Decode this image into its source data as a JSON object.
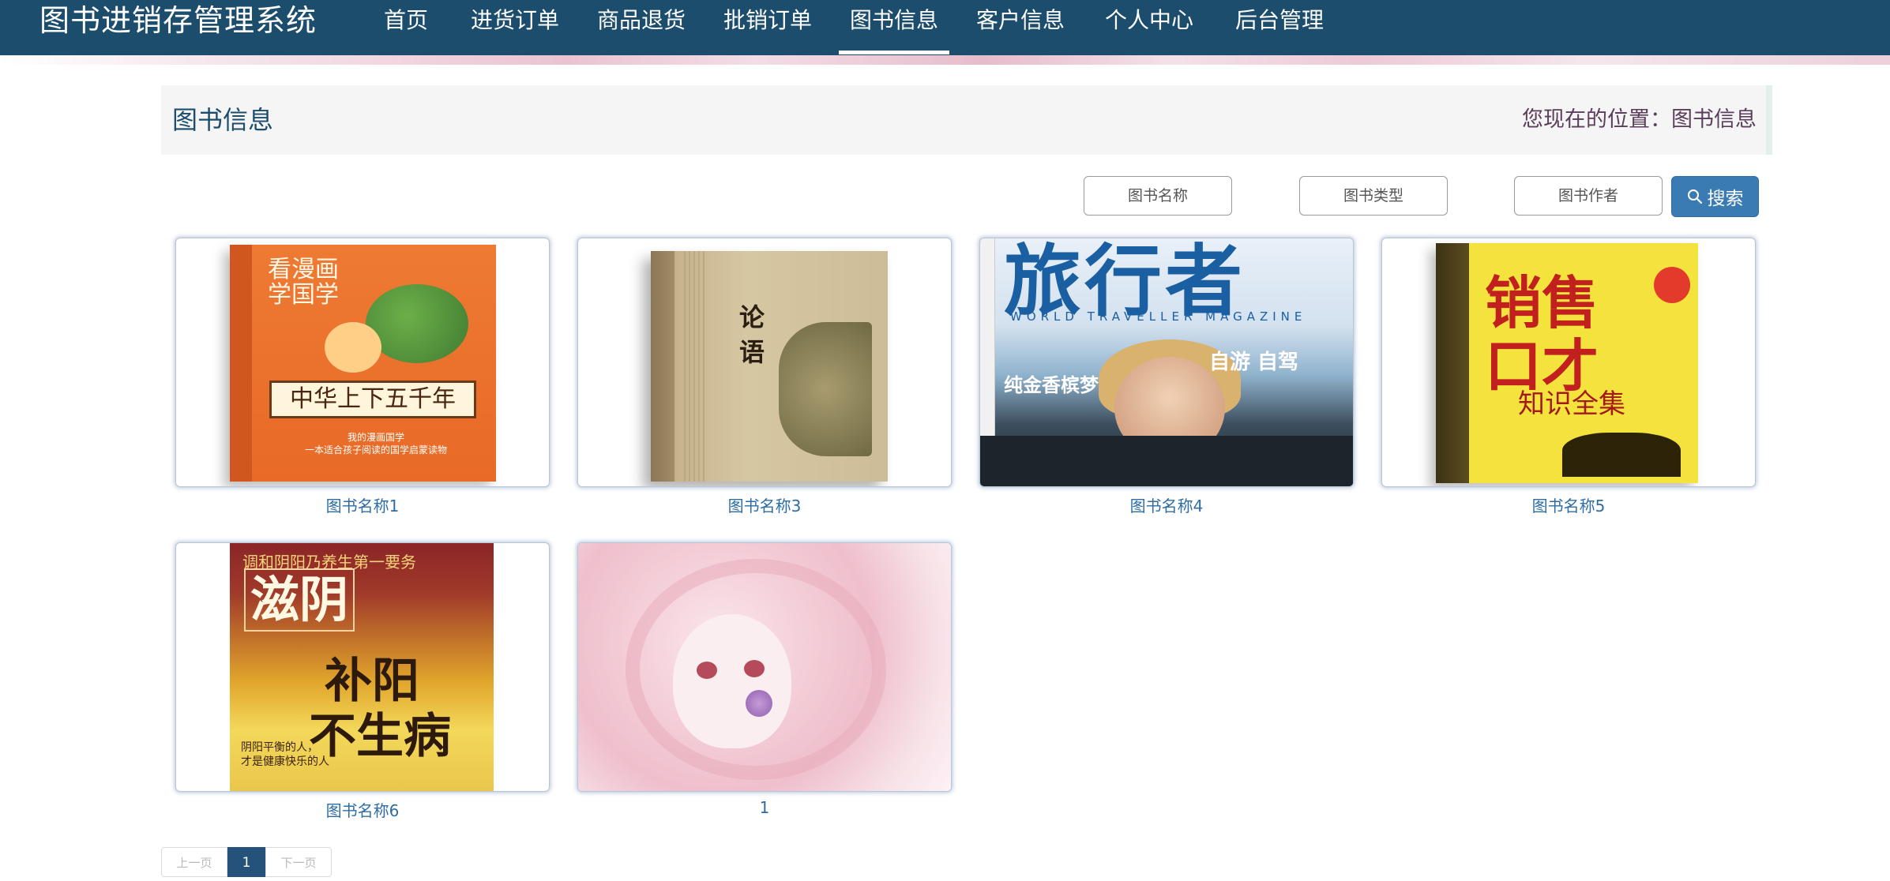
{
  "app": {
    "title": "图书进销存管理系统"
  },
  "nav": {
    "items": [
      {
        "label": "首页"
      },
      {
        "label": "进货订单"
      },
      {
        "label": "商品退货"
      },
      {
        "label": "批销订单"
      },
      {
        "label": "图书信息",
        "active": true
      },
      {
        "label": "客户信息"
      },
      {
        "label": "个人中心"
      },
      {
        "label": "后台管理"
      }
    ]
  },
  "header": {
    "page_title": "图书信息",
    "breadcrumb": "您现在的位置：图书信息"
  },
  "search": {
    "name_placeholder": "图书名称",
    "type_placeholder": "图书类型",
    "author_placeholder": "图书作者",
    "button_label": "搜索",
    "button_icon": "search-icon"
  },
  "books": [
    {
      "name": "图书名称1",
      "cover": "cover-image"
    },
    {
      "name": "图书名称3",
      "cover": "cover-image"
    },
    {
      "name": "图书名称4",
      "cover": "cover-image"
    },
    {
      "name": "图书名称5",
      "cover": "cover-image"
    },
    {
      "name": "图书名称6",
      "cover": "cover-image"
    },
    {
      "name": "1",
      "cover": "cover-image"
    }
  ],
  "covers": {
    "c1": {
      "title_top": "看漫画\n学国学",
      "band": "中华上下五千年",
      "sub": "我的漫画国学\n一本适合孩子阅读的国学启蒙读物"
    },
    "c2": {
      "title": "论\n语"
    },
    "c3": {
      "masthead": "旅行者",
      "strap": "WORLD TRAVELLER MAGAZINE",
      "line1": "纯金香槟梦",
      "line2": "自游 自驾"
    },
    "c4": {
      "big": "销售\n口才",
      "mid": "知识全集"
    },
    "c5": {
      "top": "调和阴阳乃养生第一要务",
      "t1": "滋阴",
      "t2": "补阳",
      "t3": "不生病",
      "sub": "阴阳平衡的人，\n才是健康快乐的人"
    }
  },
  "pagination": {
    "prev_label": "上一页",
    "current": "1",
    "next_label": "下一页"
  },
  "colors": {
    "nav_bg": "#1c4d6c",
    "accent": "#3a7bb3",
    "link": "#2d6da3",
    "breadcrumb": "#5a3e5b"
  }
}
